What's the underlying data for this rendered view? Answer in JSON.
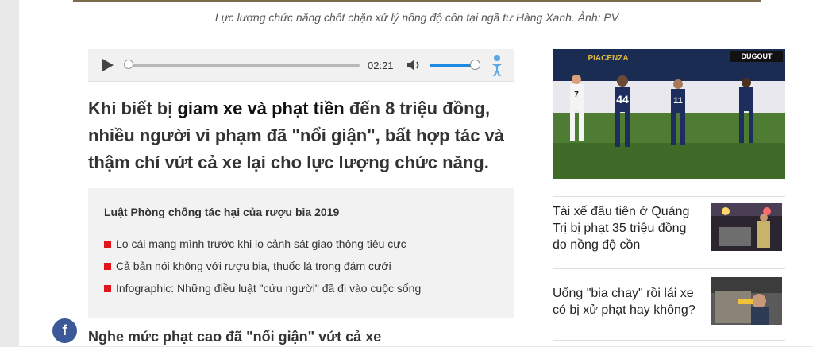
{
  "photo_caption": "Lực lượng chức năng chốt chặn xử lý nồng độ cồn tại ngã tư Hàng Xanh. Ảnh: PV",
  "audio_player": {
    "time": "02:21",
    "progress": 0.0,
    "volume": 0.9
  },
  "lead": {
    "part1": "Khi biết bị ",
    "highlight": "giam xe và phạt tiền",
    "part2": " đến 8 triệu đồng, nhiều người vi phạm đã \"nổi giận\", bất hợp tác và thậm chí vứt cả xe lại cho lực lượng chức năng."
  },
  "related_box": {
    "title": "Luật Phòng chống tác hại của rượu bia 2019",
    "items": [
      "Lo cái mạng mình trước khi lo cảnh sát giao thông tiêu cực",
      "Cả bản nói không với rượu bia, thuốc lá trong đám cưới",
      "Infographic: Những điều luật \"cứu người\" đã đi vào cuộc sống"
    ]
  },
  "share": {
    "facebook_label": "f"
  },
  "subheading": "Nghe mức phạt cao đã \"nổi giận\" vứt cả xe",
  "sidebar": {
    "hero_image": {
      "scoreboard_text": "DUGOUT",
      "banner_text": "PIACENZA",
      "player_numbers": [
        "7",
        "44",
        "11"
      ]
    },
    "items": [
      {
        "title": "Tài xế đầu tiên ở Quảng Trị bị phạt 35 triệu đồng do nồng độ cồn"
      },
      {
        "title": "Uống \"bia chay\" rồi lái xe có bị xử phạt hay không?"
      }
    ]
  },
  "colors": {
    "accent_red": "#e3151a",
    "volume_blue": "#1e88e5",
    "facebook": "#3b5998"
  }
}
